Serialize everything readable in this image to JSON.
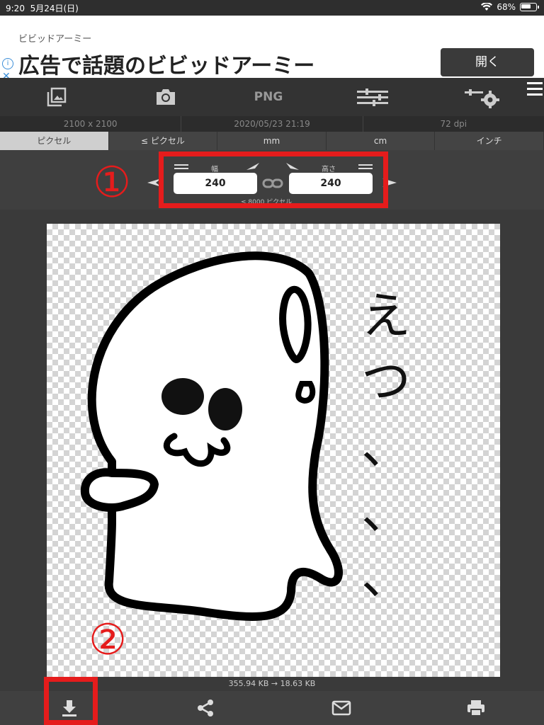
{
  "status": {
    "time": "9:20",
    "date": "5月24日(日)",
    "battery": "68%"
  },
  "ad": {
    "small": "ビビッドアーミー",
    "title": "広告で話題のビビッドアーミー",
    "info_icon": "info-icon",
    "close_icon": "close-x",
    "open_button": "開く"
  },
  "toolbar": {
    "format_label": "PNG",
    "icons": [
      "photo-library-icon",
      "camera-icon",
      "png-format-icon",
      "sliders-icon",
      "settings-icon"
    ]
  },
  "info": {
    "resolution": "2100 x 2100",
    "datetime": "2020/05/23 21:19",
    "dpi": "72 dpi"
  },
  "units": [
    "ピクセル",
    "≤ ピクセル",
    "mm",
    "cm",
    "インチ"
  ],
  "size": {
    "width_label": "幅",
    "height_label": "高さ",
    "width_value": "240",
    "height_value": "240",
    "limit": "≤ 8000 ピクセル"
  },
  "annotations": {
    "mark1": "①",
    "mark2": "②",
    "accent": "#e51c1c"
  },
  "image_text": [
    "え",
    "つ",
    "、",
    "、",
    "、"
  ],
  "file": {
    "size_text": "355.94 KB → 18.63 KB"
  },
  "bottom": {
    "icons": [
      "download-icon",
      "share-icon",
      "mail-icon",
      "print-icon"
    ]
  }
}
